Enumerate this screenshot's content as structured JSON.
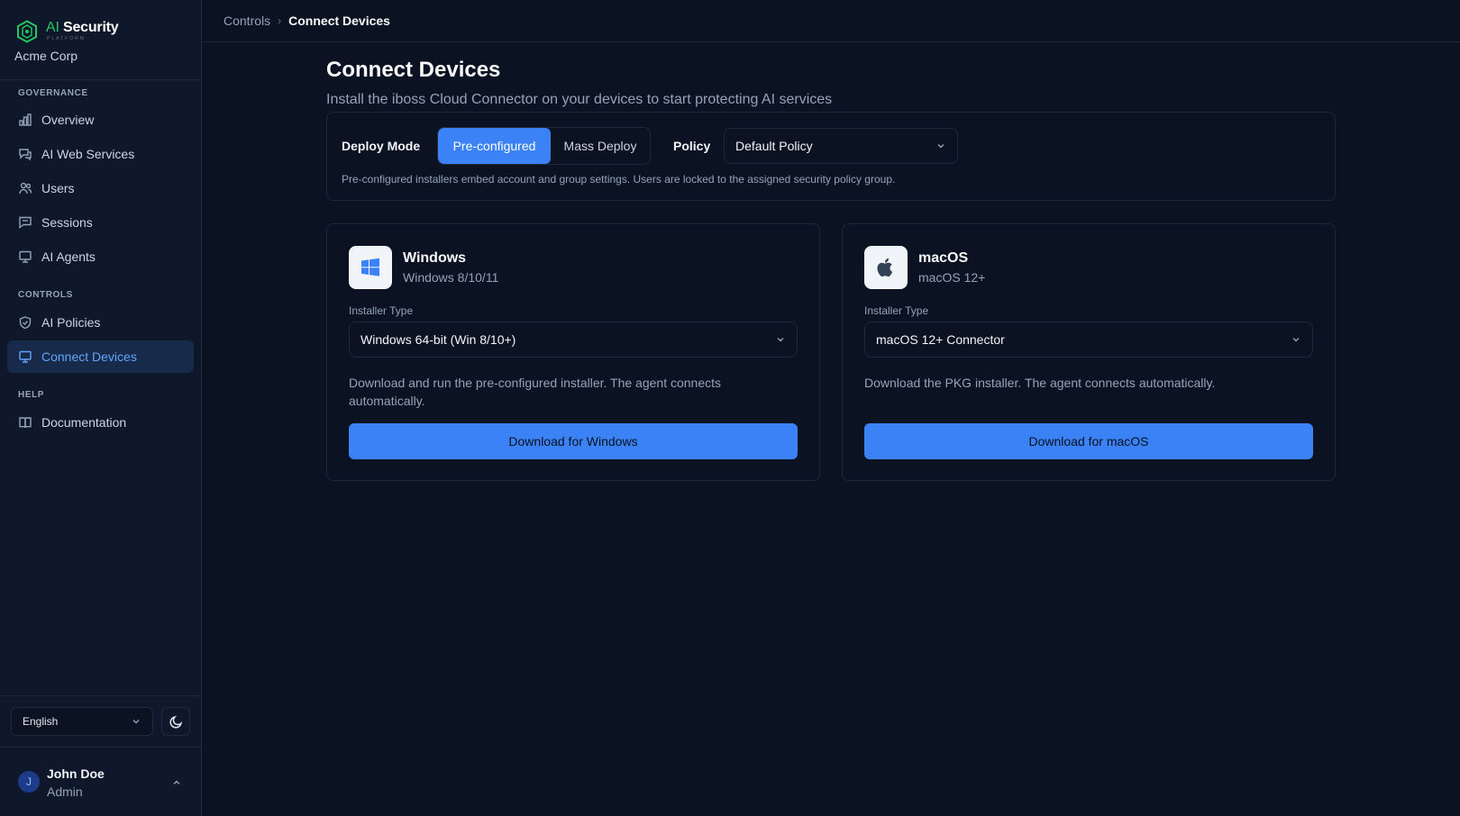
{
  "brand": {
    "ai": "AI",
    "security": "Security",
    "sub": "PLATFORM",
    "org": "Acme Corp"
  },
  "sidebar": {
    "sections": [
      {
        "label": "GOVERNANCE",
        "items": [
          "Overview",
          "AI Web Services",
          "Users",
          "Sessions",
          "AI Agents"
        ]
      },
      {
        "label": "CONTROLS",
        "items": [
          "AI Policies",
          "Connect Devices"
        ]
      },
      {
        "label": "HELP",
        "items": [
          "Documentation"
        ]
      }
    ],
    "active": "Connect Devices",
    "language": "English"
  },
  "user": {
    "initial": "J",
    "name": "John Doe",
    "role": "Admin"
  },
  "breadcrumb": {
    "parent": "Controls",
    "current": "Connect Devices"
  },
  "page": {
    "title": "Connect Devices",
    "subtitle": "Install the iboss Cloud Connector on your devices to start protecting AI services"
  },
  "deploy": {
    "mode_label": "Deploy Mode",
    "modes": [
      "Pre-configured",
      "Mass Deploy"
    ],
    "selected_mode": "Pre-configured",
    "policy_label": "Policy",
    "policy_value": "Default Policy",
    "note": "Pre-configured installers embed account and group settings. Users are locked to the assigned security policy group."
  },
  "platforms": {
    "windows": {
      "name": "Windows",
      "version": "Windows 8/10/11",
      "installer_label": "Installer Type",
      "installer_value": "Windows 64-bit (Win 8/10+)",
      "description": "Download and run the pre-configured installer. The agent connects automatically.",
      "button": "Download for Windows",
      "icon": "windows-icon"
    },
    "macos": {
      "name": "macOS",
      "version": "macOS 12+",
      "installer_label": "Installer Type",
      "installer_value": "macOS 12+ Connector",
      "description": "Download the PKG installer. The agent connects automatically.",
      "button": "Download for macOS",
      "icon": "apple-icon"
    }
  },
  "colors": {
    "accent": "#3b82f6",
    "brand_green": "#22c55e",
    "background": "#0b1222",
    "sidebar": "#0f172a"
  }
}
